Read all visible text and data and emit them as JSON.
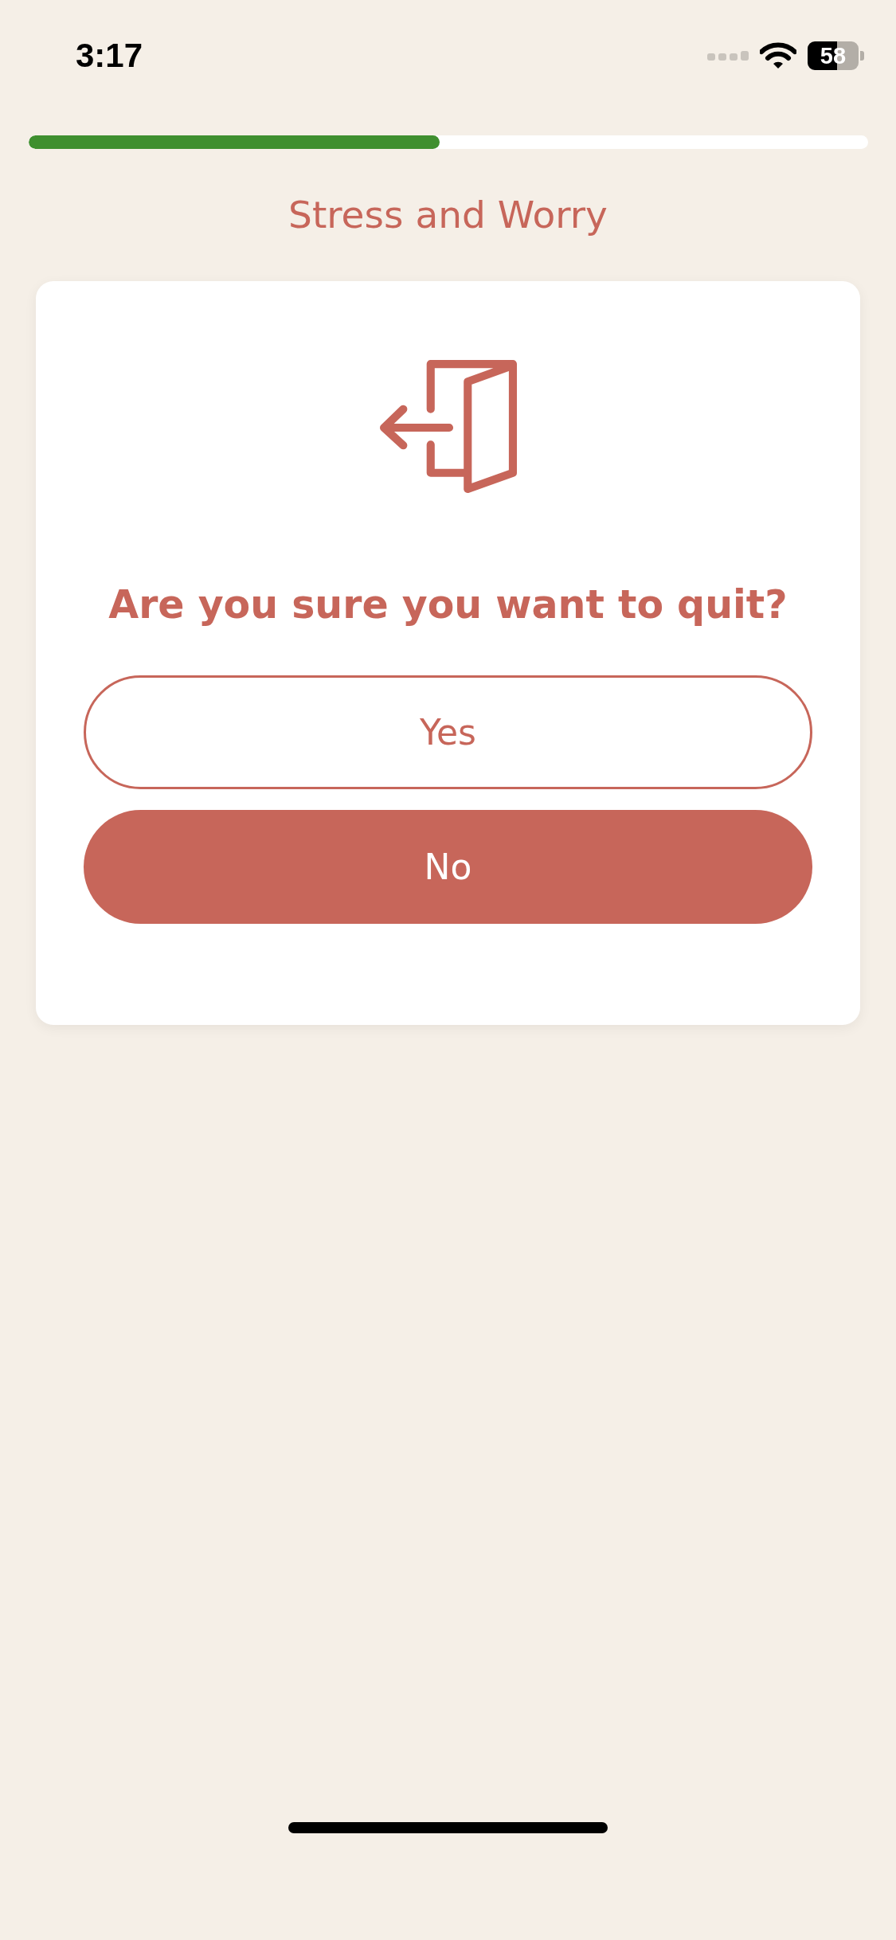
{
  "status_bar": {
    "time": "3:17",
    "battery": "58"
  },
  "progress": {
    "level": 0.49
  },
  "title": "Stress and Worry",
  "dialog": {
    "question": "Are you sure you want to quit?",
    "buttons": [
      {
        "label": "Yes",
        "kind": "outline"
      },
      {
        "label": "No",
        "kind": "filled"
      }
    ]
  }
}
